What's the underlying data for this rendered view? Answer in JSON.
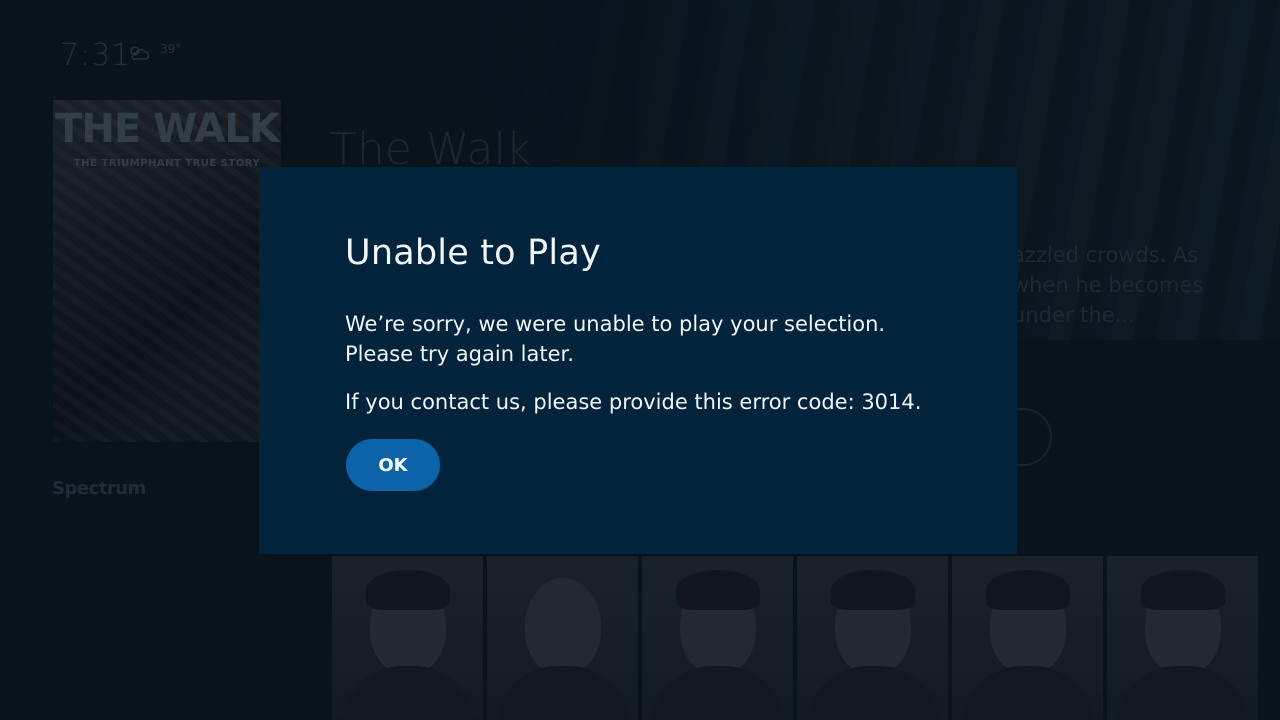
{
  "status_bar": {
    "time": "7:31",
    "weather_icon": "partly-cloudy-icon",
    "temperature": "39°"
  },
  "background": {
    "poster": {
      "title": "THE WALK",
      "tagline": "THE TRIUMPHANT TRUE STORY"
    },
    "brand": "Spectrum",
    "title": "The Walk",
    "description_fragment": "azzled crowds. As\nwhen he becomes\nunder the..."
  },
  "dialog": {
    "title": "Unable to Play",
    "message_line1": "We’re sorry, we were unable to play your selection.",
    "message_line2": "Please try again later.",
    "error_line": "If you contact us, please provide this error code: 3014.",
    "ok_label": "OK"
  },
  "colors": {
    "dialog_bg": "#02233c",
    "ok_button": "#0b63a8",
    "page_bg": "#0a1620"
  }
}
